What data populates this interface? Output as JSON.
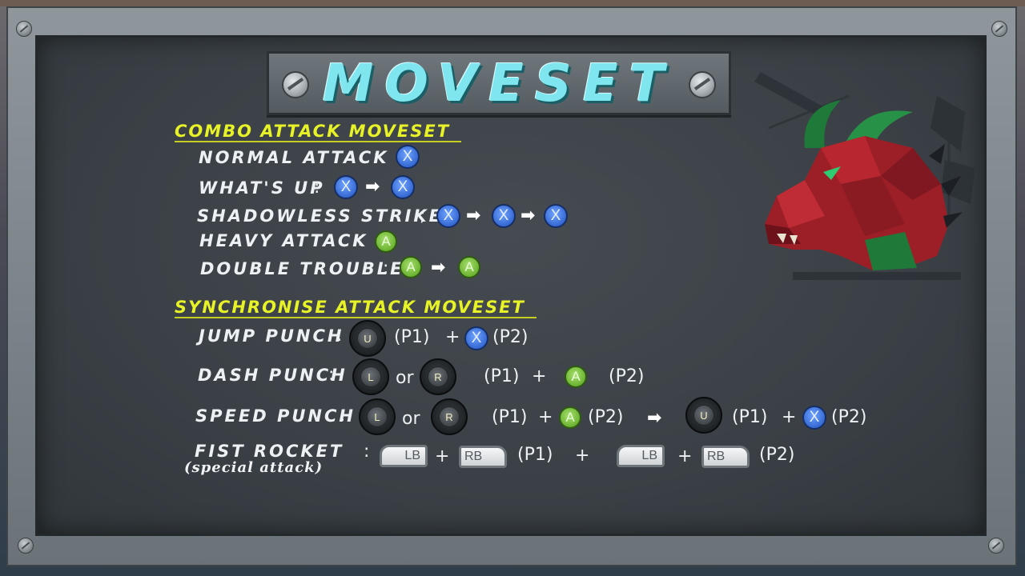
{
  "title": "MOVESET",
  "combo": {
    "heading": "COMBO ATTACK MOVESET",
    "normal_attack": {
      "label": "NORMAL ATTACK",
      "sep": ":"
    },
    "whats_up": {
      "label": "WHAT'S UP",
      "sep": ":"
    },
    "shadowless_strike": {
      "label": "SHADOWLESS STRIKE",
      "sep": ";"
    },
    "heavy_attack": {
      "label": "HEAVY ATTACK",
      "sep": ":"
    },
    "double_trouble": {
      "label": "DOUBLE TROUBLE",
      "sep": ":"
    }
  },
  "sync": {
    "heading": "SYNCHRONISE ATTACK MOVESET",
    "jump_punch": {
      "label": "JUMP PUNCH",
      "sep": ":"
    },
    "dash_punch": {
      "label": "DASH PUNCH",
      "sep": ":"
    },
    "speed_punch": {
      "label": "SPEED PUNCH",
      "sep": ":"
    },
    "fist_rocket": {
      "label": "FIST ROCKET",
      "sublabel": "(special attack)",
      "sep": ":"
    }
  },
  "buttons": {
    "x": "X",
    "a": "A",
    "u": "U",
    "l": "L",
    "r": "R",
    "lb": "LB",
    "rb": "RB"
  },
  "text": {
    "p1": "(P1)",
    "p2": "(P2)",
    "plus": "+",
    "or": "or",
    "arrow": "➡"
  },
  "colors": {
    "heading": "#e7f227",
    "title": "#7fe6ef",
    "x_button": "#3669d3",
    "a_button": "#6cb331"
  }
}
